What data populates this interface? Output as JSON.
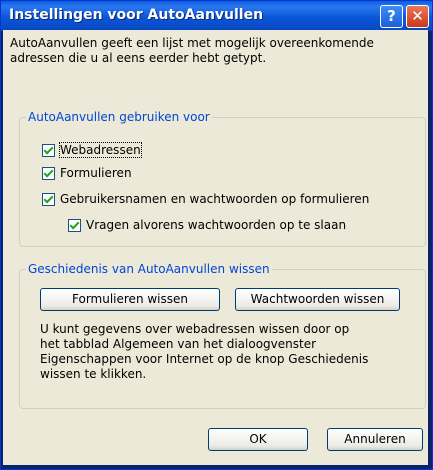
{
  "window": {
    "title": "Instellingen voor AutoAanvullen",
    "help_glyph": "?",
    "close_glyph": "✕"
  },
  "intro": {
    "line1": "AutoAanvullen geeft een lijst met mogelijk overeenkomende",
    "line2": "adressen die u al eens eerder hebt getypt."
  },
  "use_group": {
    "legend": "AutoAanvullen gebruiken voor",
    "items": [
      {
        "label": "Webadressen",
        "checked": true
      },
      {
        "label": "Formulieren",
        "checked": true
      },
      {
        "label": "Gebruikersnamen en wachtwoorden op formulieren",
        "checked": true
      },
      {
        "label": "Vragen alvorens wachtwoorden op te slaan",
        "checked": true
      }
    ]
  },
  "clear_group": {
    "legend": "Geschiedenis van AutoAanvullen wissen",
    "clear_forms_label": "Formulieren wissen",
    "clear_passwords_label": "Wachtwoorden wissen",
    "desc_lines": [
      "U kunt gegevens over webadressen wissen door op",
      "het tabblad Algemeen van het dialoogvenster",
      "Eigenschappen voor Internet op de knop Geschiedenis",
      "wissen te klikken."
    ]
  },
  "footer": {
    "ok_label": "OK",
    "cancel_label": "Annuleren"
  },
  "colors": {
    "titlebar": "#0b56d8",
    "dialog_bg": "#ece9d8",
    "legend_text": "#0046d5",
    "check": "#21a121"
  },
  "icons": [
    "help-icon",
    "close-icon",
    "checkbox-checked-icon"
  ]
}
